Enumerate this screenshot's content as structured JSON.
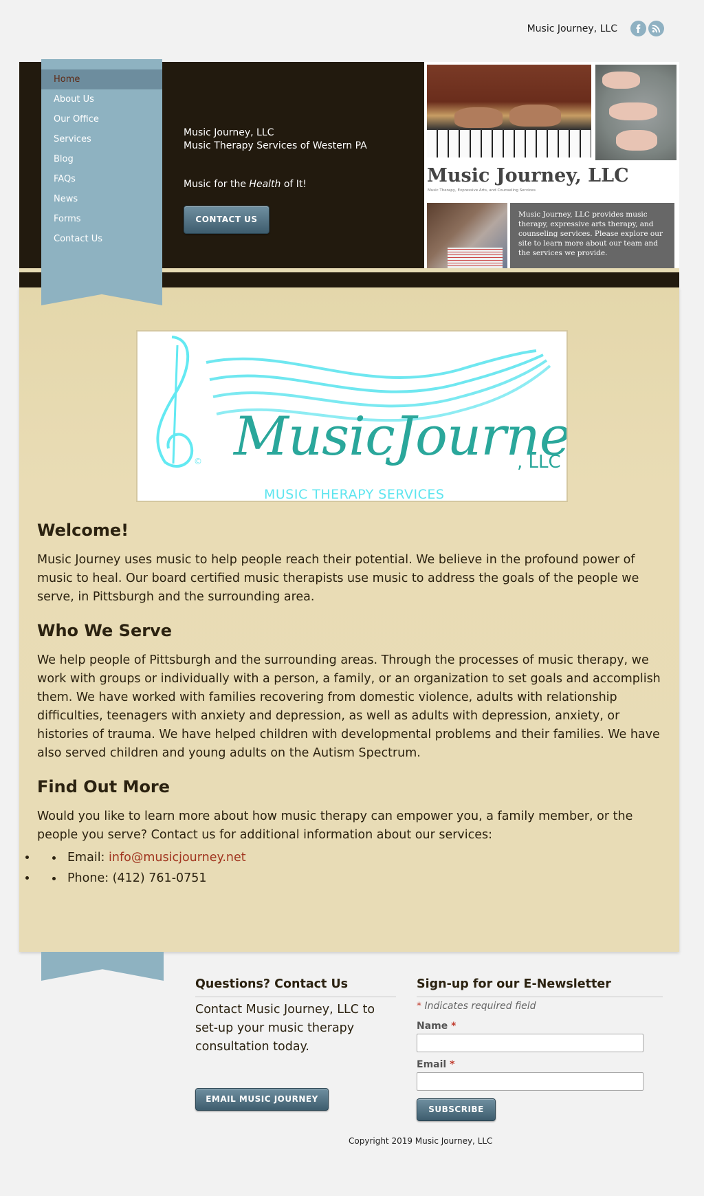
{
  "top_bar": {
    "site_name": "Music Journey, LLC",
    "icons": [
      "facebook-icon",
      "rss-icon"
    ]
  },
  "nav": {
    "items": [
      {
        "label": "Home",
        "active": true
      },
      {
        "label": "About Us"
      },
      {
        "label": "Our Office"
      },
      {
        "label": "Services"
      },
      {
        "label": "Blog"
      },
      {
        "label": "FAQs"
      },
      {
        "label": "News"
      },
      {
        "label": "Forms"
      },
      {
        "label": "Contact Us"
      }
    ]
  },
  "header": {
    "line1": "Music Journey, LLC",
    "line2": "Music Therapy Services of Western PA",
    "motto_pre": "Music for the ",
    "motto_em": "Health",
    "motto_post": " of It!",
    "contact_button": "CONTACT US"
  },
  "collage": {
    "title": "Music Journey, LLC",
    "subtitle": "Music Therapy, Expressive Arts, and Counseling Services",
    "box_text": "Music Journey, LLC provides music therapy, expressive arts therapy, and counseling services. Please explore our site to learn more about our team and the services we provide."
  },
  "logo": {
    "main": "MusicJourney",
    "llc": ", LLC",
    "services": "MUSIC THERAPY SERVICES",
    "copyright_mark": "©"
  },
  "content": {
    "welcome_title": "Welcome!",
    "welcome_text": "Music Journey uses music to help people reach their potential. We believe in the profound power of music to heal. Our board certified music therapists use music to address the goals of the people we serve, in Pittsburgh and the surrounding area.",
    "serve_title": "Who We Serve",
    "serve_text": "We help people of Pittsburgh and the surrounding areas. Through the processes of music therapy, we work with groups or individually with a person, a family, or an organization to set goals and accomplish them. We have worked with families recovering from domestic violence, adults with relationship difficulties, teenagers with anxiety and depression, as well as adults with depression, anxiety, or histories of trauma. We have helped children with developmental problems and their families. We have also served children and young adults on the Autism Spectrum.",
    "more_title": "Find Out More",
    "more_text": "Would you like to learn more about how music therapy can empower you, a family member, or the people you serve? Contact us for additional information about our services:",
    "email_label": "Email: ",
    "email_value": "info@musicjourney.net",
    "phone_text": "Phone: (412) 761-0751"
  },
  "footer": {
    "contact_title": "Questions? Contact Us",
    "contact_text": "Contact Music Journey, LLC to set-up your music therapy consultation today.",
    "email_button": "EMAIL MUSIC JOURNEY",
    "newsletter_title": "Sign-up for our E-Newsletter",
    "required_star": "*",
    "required_note": " Indicates required field",
    "name_label": "Name ",
    "email_field_label": "Email ",
    "subscribe_button": "SUBSCRIBE",
    "copyright": "Copyright 2019 Music Journey, LLC"
  },
  "colors": {
    "header_bg": "#221a0e",
    "ribbon": "#8eb2c1",
    "content_bg": "#e8dcb6",
    "link": "#a0351f",
    "button": "#4e6e80"
  }
}
